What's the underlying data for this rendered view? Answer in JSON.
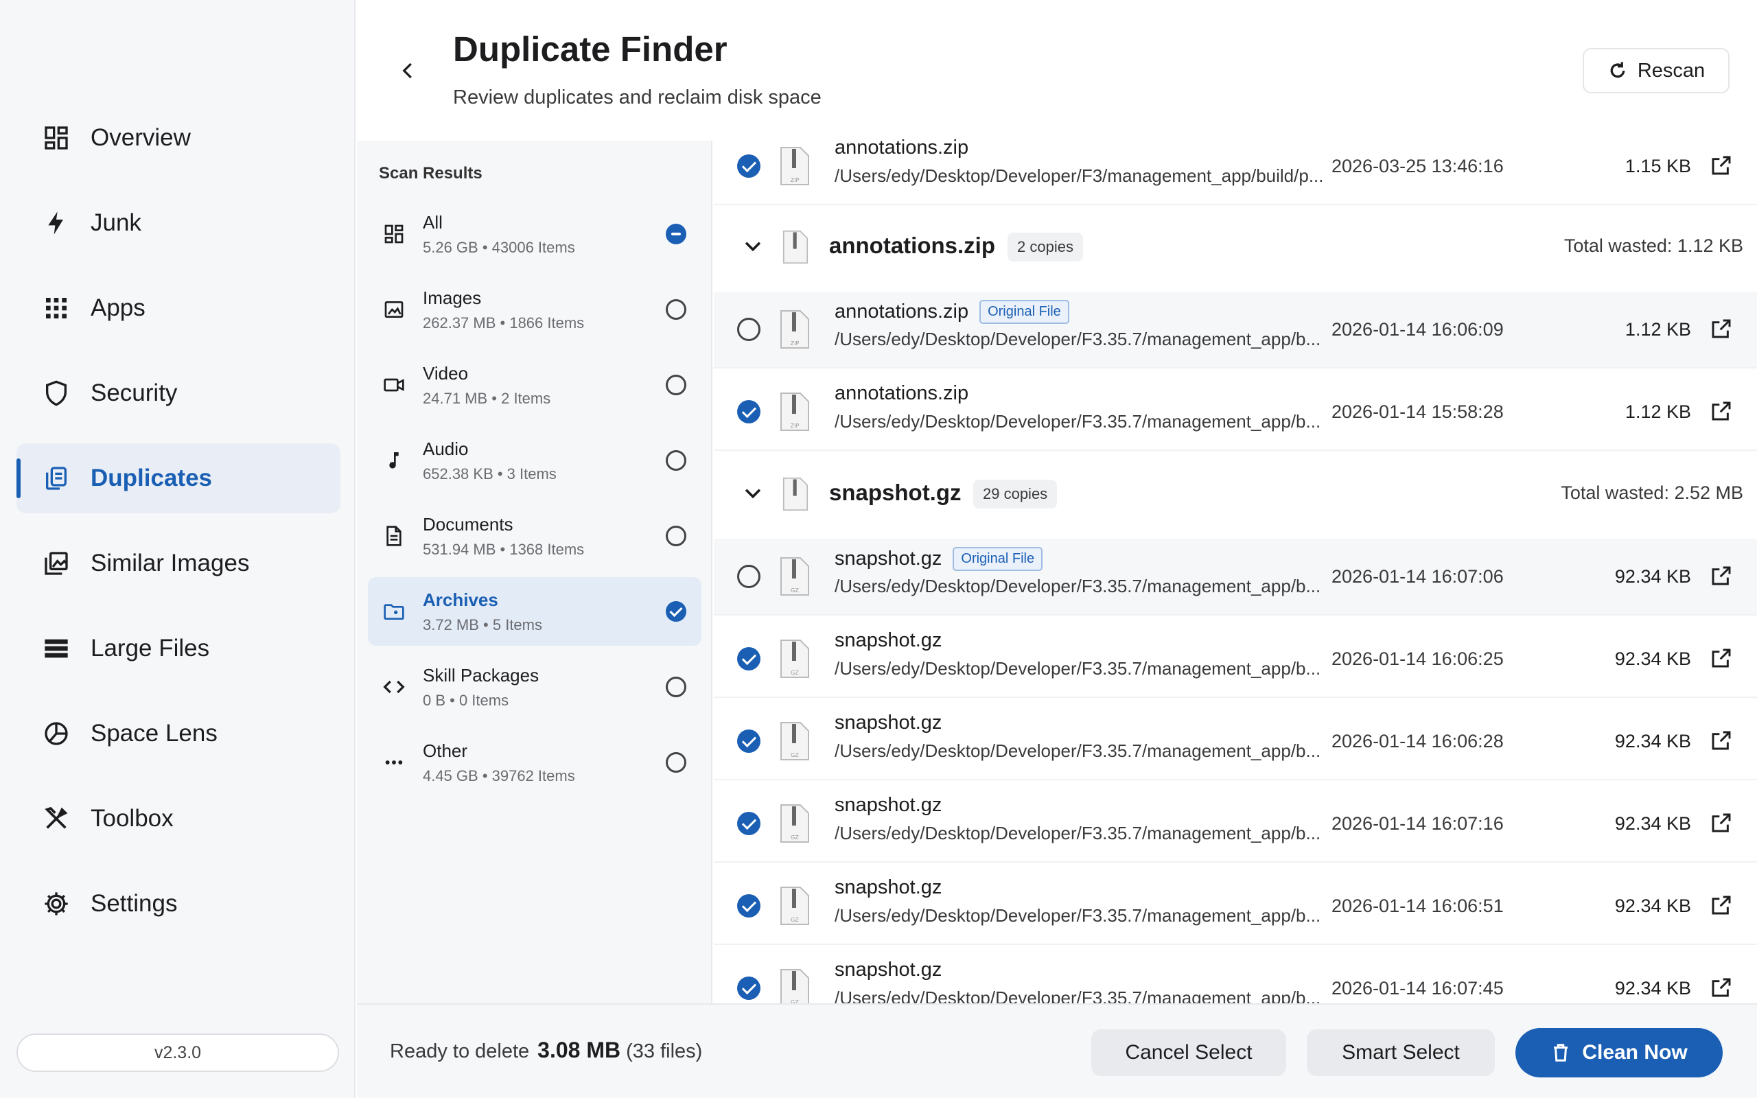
{
  "window": {
    "title": "Duplicate Finder"
  },
  "sidebar": {
    "items": [
      {
        "label": "Overview",
        "icon": "overview-icon"
      },
      {
        "label": "Junk",
        "icon": "bolt-icon"
      },
      {
        "label": "Apps",
        "icon": "apps-grid-icon"
      },
      {
        "label": "Security",
        "icon": "shield-icon"
      },
      {
        "label": "Duplicates",
        "icon": "duplicates-icon",
        "active": true
      },
      {
        "label": "Similar Images",
        "icon": "images-icon"
      },
      {
        "label": "Large Files",
        "icon": "large-files-icon"
      },
      {
        "label": "Space Lens",
        "icon": "pie-chart-icon"
      },
      {
        "label": "Toolbox",
        "icon": "tools-icon"
      },
      {
        "label": "Settings",
        "icon": "gear-icon"
      }
    ],
    "version": "v2.3.0"
  },
  "header": {
    "title": "Duplicate Finder",
    "subtitle": "Review duplicates and reclaim disk space",
    "rescan_label": "Rescan"
  },
  "scan_results": {
    "heading": "Scan Results",
    "categories": [
      {
        "name": "All",
        "meta": "5.26 GB • 43006 Items",
        "state": "partial",
        "icon": "overview-icon"
      },
      {
        "name": "Images",
        "meta": "262.37 MB • 1866 Items",
        "state": "off",
        "icon": "image-icon"
      },
      {
        "name": "Video",
        "meta": "24.71 MB • 2 Items",
        "state": "off",
        "icon": "video-icon"
      },
      {
        "name": "Audio",
        "meta": "652.38 KB • 3 Items",
        "state": "off",
        "icon": "music-note-icon"
      },
      {
        "name": "Documents",
        "meta": "531.94 MB • 1368 Items",
        "state": "off",
        "icon": "document-icon"
      },
      {
        "name": "Archives",
        "meta": "3.72 MB • 5 Items",
        "state": "on",
        "icon": "archive-folder-icon",
        "active": true
      },
      {
        "name": "Skill Packages",
        "meta": "0 B • 0 Items",
        "state": "off",
        "icon": "code-icon"
      },
      {
        "name": "Other",
        "meta": "4.45 GB • 39762 Items",
        "state": "off",
        "icon": "more-dots-icon"
      }
    ]
  },
  "files": {
    "original_badge": "Original File",
    "top_row": {
      "name": "annotations.zip",
      "path": "/Users/edy/Desktop/Developer/F3/management_app/build/p...",
      "date": "2026-03-25 13:46:16",
      "size": "1.15 KB",
      "checked": true
    },
    "groups": [
      {
        "name": "annotations.zip",
        "copies": "2 copies",
        "wasted": "Total wasted: 1.12 KB",
        "rows": [
          {
            "name": "annotations.zip",
            "path": "/Users/edy/Desktop/Developer/F3.35.7/management_app/b...",
            "date": "2026-01-14 16:06:09",
            "size": "1.12 KB",
            "checked": false,
            "original": true
          },
          {
            "name": "annotations.zip",
            "path": "/Users/edy/Desktop/Developer/F3.35.7/management_app/b...",
            "date": "2026-01-14 15:58:28",
            "size": "1.12 KB",
            "checked": true
          }
        ]
      },
      {
        "name": "snapshot.gz",
        "copies": "29 copies",
        "wasted": "Total wasted: 2.52 MB",
        "rows": [
          {
            "name": "snapshot.gz",
            "path": "/Users/edy/Desktop/Developer/F3.35.7/management_app/b...",
            "date": "2026-01-14 16:07:06",
            "size": "92.34 KB",
            "checked": false,
            "original": true
          },
          {
            "name": "snapshot.gz",
            "path": "/Users/edy/Desktop/Developer/F3.35.7/management_app/b...",
            "date": "2026-01-14 16:06:25",
            "size": "92.34 KB",
            "checked": true
          },
          {
            "name": "snapshot.gz",
            "path": "/Users/edy/Desktop/Developer/F3.35.7/management_app/b...",
            "date": "2026-01-14 16:06:28",
            "size": "92.34 KB",
            "checked": true
          },
          {
            "name": "snapshot.gz",
            "path": "/Users/edy/Desktop/Developer/F3.35.7/management_app/b...",
            "date": "2026-01-14 16:07:16",
            "size": "92.34 KB",
            "checked": true
          },
          {
            "name": "snapshot.gz",
            "path": "/Users/edy/Desktop/Developer/F3.35.7/management_app/b...",
            "date": "2026-01-14 16:06:51",
            "size": "92.34 KB",
            "checked": true
          },
          {
            "name": "snapshot.gz",
            "path": "/Users/edy/Desktop/Developer/F3.35.7/management_app/b...",
            "date": "2026-01-14 16:07:45",
            "size": "92.34 KB",
            "checked": true
          }
        ]
      }
    ]
  },
  "footer": {
    "ready_label": "Ready to delete",
    "ready_size": "3.08 MB",
    "ready_count": "(33 files)",
    "cancel_label": "Cancel Select",
    "smart_label": "Smart Select",
    "clean_label": "Clean Now"
  },
  "colors": {
    "accent": "#1a5fb4",
    "sidebar_bg": "#f6f7f9",
    "active_bg": "#e9eef6"
  }
}
